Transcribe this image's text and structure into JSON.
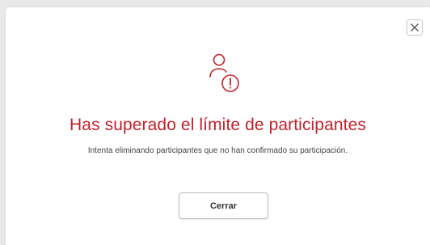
{
  "dialog": {
    "title": "Has superado el límite de participantes",
    "message": "Intenta eliminando participantes que no han confirmado su participación.",
    "primary_button_label": "Cerrar",
    "close_icon": "close-icon",
    "alert_icon": "user-warning-icon"
  },
  "colors": {
    "accent": "#c4222b",
    "backdrop": "#e9e9e9",
    "panel": "#ffffff",
    "body_text": "#444444"
  }
}
